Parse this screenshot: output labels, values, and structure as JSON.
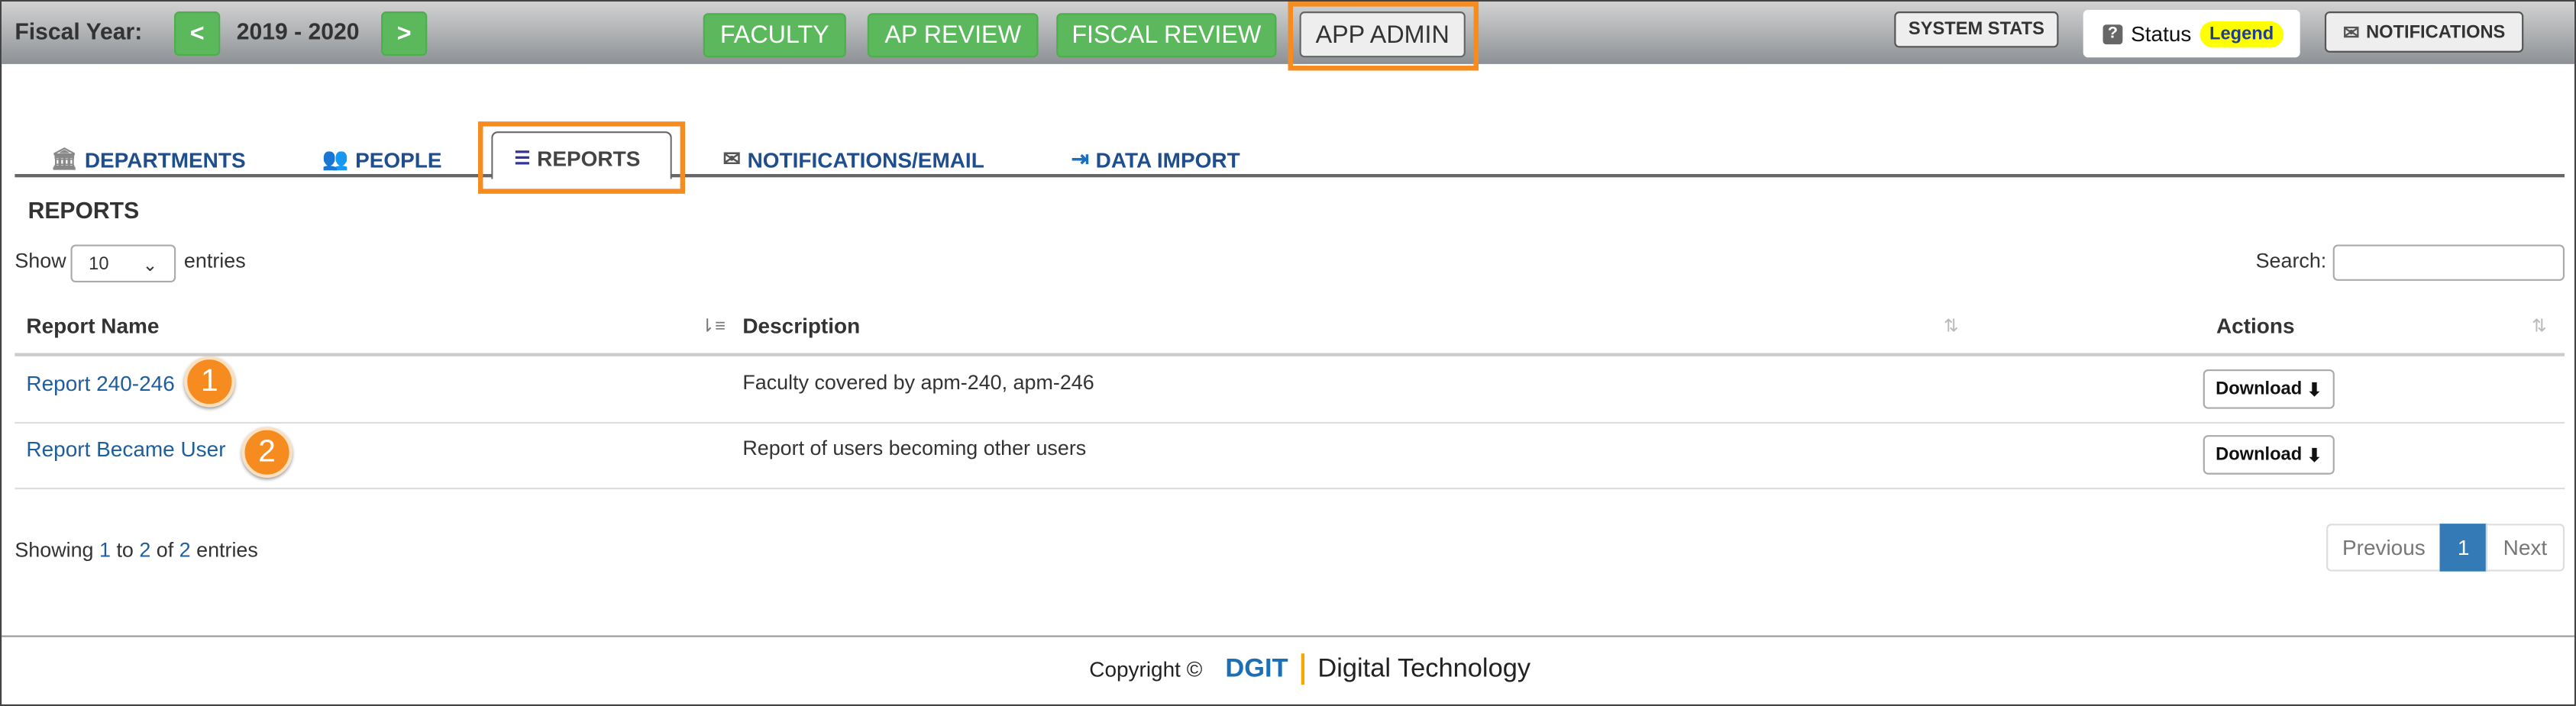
{
  "header": {
    "fiscal_label": "Fiscal Year:",
    "prev": "<",
    "year": "2019 - 2020",
    "next": ">",
    "nav": [
      "FACULTY",
      "AP REVIEW",
      "FISCAL REVIEW",
      "APP ADMIN"
    ],
    "system_stats": "SYSTEM STATS",
    "status_label": "Status",
    "legend": "Legend",
    "notifications": "NOTIFICATIONS"
  },
  "tabs": [
    "DEPARTMENTS",
    "PEOPLE",
    "REPORTS",
    "NOTIFICATIONS/EMAIL",
    "DATA IMPORT"
  ],
  "active_tab": "REPORTS",
  "section_title": "REPORTS",
  "length": {
    "show": "Show",
    "value": "10",
    "entries": "entries"
  },
  "search": {
    "label": "Search:",
    "value": ""
  },
  "table": {
    "columns": [
      "Report Name",
      "Description",
      "Actions"
    ],
    "rows": [
      {
        "name": "Report 240-246",
        "description": "Faculty covered by apm-240, apm-246",
        "action": "Download",
        "badge": "1"
      },
      {
        "name": "Report Became User",
        "description": "Report of users becoming other users",
        "action": "Download",
        "badge": "2"
      }
    ]
  },
  "info": {
    "pre": "Showing ",
    "from": "1",
    "mid1": " to ",
    "to": "2",
    "mid2": " of ",
    "total": "2",
    "post": " entries"
  },
  "pagination": {
    "previous": "Previous",
    "current": "1",
    "next": "Next"
  },
  "footer": {
    "copyright": "Copyright ©",
    "brand": "DGIT",
    "brand_name": "Digital Technology"
  },
  "colors": {
    "green": "#5cb85c",
    "highlight": "#f68b1f",
    "link": "#1f5e9c",
    "page_active": "#337ab7",
    "legend_bg": "#ffff00"
  }
}
